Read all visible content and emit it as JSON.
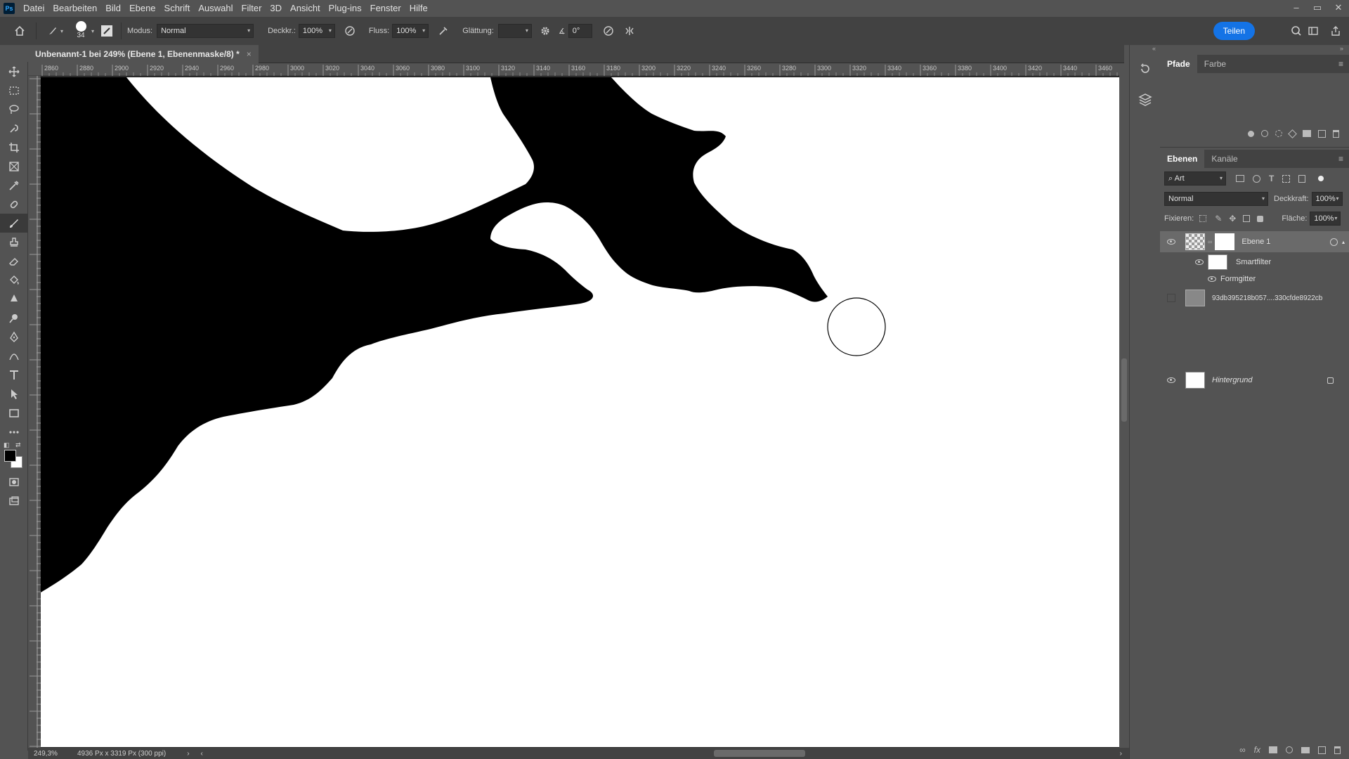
{
  "app": {
    "logo": "Ps"
  },
  "menu": [
    "Datei",
    "Bearbeiten",
    "Bild",
    "Ebene",
    "Schrift",
    "Auswahl",
    "Filter",
    "3D",
    "Ansicht",
    "Plug-ins",
    "Fenster",
    "Hilfe"
  ],
  "window_controls": {
    "minimize": "–",
    "restore": "▭",
    "close": "✕"
  },
  "options": {
    "brush_size": "34",
    "mode_label": "Modus:",
    "mode_value": "Normal",
    "opacity_label": "Deckkr.:",
    "opacity_value": "100%",
    "flow_label": "Fluss:",
    "flow_value": "100%",
    "smoothing_label": "Glättung:",
    "smoothing_value": "",
    "angle_value": "0°",
    "share_label": "Teilen"
  },
  "document": {
    "tab_title": "Unbenannt-1 bei 249% (Ebene 1, Ebenenmaske/8) *",
    "close": "×",
    "ruler_ticks": [
      "2860",
      "2880",
      "2900",
      "2920",
      "2940",
      "2960",
      "2980",
      "3000",
      "3020",
      "3040",
      "3060",
      "3080",
      "3100",
      "3120",
      "3140",
      "3160",
      "3180",
      "3200",
      "3220",
      "3240",
      "3260",
      "3280",
      "3300",
      "3320",
      "3340",
      "3360",
      "3380",
      "3400",
      "3420",
      "3440",
      "3460"
    ]
  },
  "status": {
    "zoom": "249,3%",
    "doc_info": "4936 Px x 3319 Px (300 ppi)"
  },
  "panels": {
    "top_tabs": [
      "Pfade",
      "Farbe"
    ],
    "layer_tabs": [
      "Ebenen",
      "Kanäle"
    ],
    "filter_kind": "Art",
    "blend_mode": "Normal",
    "opacity_label": "Deckkraft:",
    "opacity_value": "100%",
    "lock_label": "Fixieren:",
    "fill_label": "Fläche:",
    "fill_value": "100%",
    "layers": [
      {
        "name": "Ebene 1",
        "visible": true,
        "selected": true
      },
      {
        "name": "Smartfilter",
        "visible": true
      },
      {
        "name": "Formgitter",
        "visible": true
      },
      {
        "name": "93db395218b057....330cfde8922cb",
        "visible": false
      },
      {
        "name": "Hintergrund",
        "visible": true,
        "locked": true
      }
    ]
  },
  "colors": {
    "accent": "#1473e6",
    "foreground": "#000000",
    "background": "#ffffff"
  }
}
